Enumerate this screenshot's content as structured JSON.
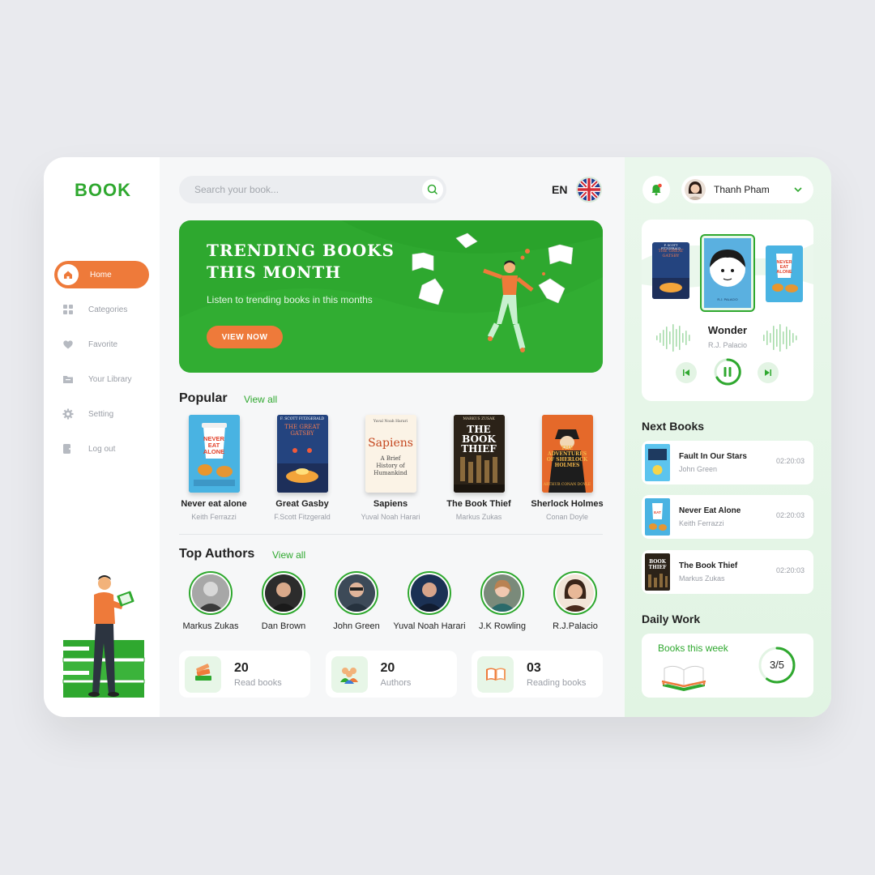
{
  "app": {
    "logo": "BOOK"
  },
  "sidebar": {
    "items": [
      {
        "label": "Home",
        "icon": "home-icon",
        "active": true
      },
      {
        "label": "Categories",
        "icon": "grid-icon"
      },
      {
        "label": "Favorite",
        "icon": "heart-icon"
      },
      {
        "label": "Your Library",
        "icon": "folder-icon"
      },
      {
        "label": "Setting",
        "icon": "gear-icon"
      },
      {
        "label": "Log out",
        "icon": "logout-icon"
      }
    ]
  },
  "header": {
    "search_placeholder": "Search your book...",
    "language": "EN",
    "flag": "uk-flag-icon"
  },
  "banner": {
    "title": "TRENDING BOOKS THIS MONTH",
    "subtitle": "Listen to trending books in this months",
    "button": "VIEW NOW"
  },
  "popular": {
    "title": "Popular",
    "view_all": "View all",
    "books": [
      {
        "title": "Never eat alone",
        "author": "Keith Ferrazzi"
      },
      {
        "title": "Great Gasby",
        "author": "F.Scott Fitzgerald"
      },
      {
        "title": "Sapiens",
        "author": "Yuval Noah Harari"
      },
      {
        "title": "The Book Thief",
        "author": "Markus Zukas"
      },
      {
        "title": "Sherlock Holmes",
        "author": "Conan Doyle"
      }
    ]
  },
  "covers": {
    "never_eat_alone": {
      "top": "NEVER EAT ALONE",
      "lines": [
        "NEVER",
        "EAT",
        "ALONE"
      ]
    },
    "gatsby": {
      "author": "F. SCOTT FITZGERALD",
      "title": "THE GREAT GATSBY"
    },
    "sapiens": {
      "author": "Yuval Noah Harari",
      "title": "Sapiens",
      "sub": "A Brief History of Humankind"
    },
    "book_thief": {
      "author": "MARKUS ZUSAK",
      "title": "THE BOOK THIEF"
    },
    "sherlock": {
      "title": "THE ADVENTURES OF SHERLOCK HOLMES",
      "author": "ARTHUR CONAN DOYLE"
    },
    "wonder": {
      "title": "wonder",
      "author": "R.J. PALACIO"
    }
  },
  "authors": {
    "title": "Top Authors",
    "view_all": "View all",
    "list": [
      {
        "name": "Markus Zukas"
      },
      {
        "name": "Dan Brown"
      },
      {
        "name": "John Green"
      },
      {
        "name": "Yuval Noah Harari"
      },
      {
        "name": "J.K Rowling"
      },
      {
        "name": "R.J.Palacio"
      }
    ]
  },
  "stats": [
    {
      "value": "20",
      "label": "Read books",
      "icon": "books-icon"
    },
    {
      "value": "20",
      "label": "Authors",
      "icon": "people-icon"
    },
    {
      "value": "03",
      "label": "Reading books",
      "icon": "open-book-icon"
    }
  ],
  "user": {
    "name": "Thanh Pham"
  },
  "player": {
    "title": "Wonder",
    "author": "R.J. Palacio"
  },
  "next_books": {
    "title": "Next Books",
    "items": [
      {
        "title": "Fault In Our Stars",
        "author": "John Green",
        "duration": "02:20:03"
      },
      {
        "title": "Never Eat Alone",
        "author": "Keith Ferrazzi",
        "duration": "02:20:03"
      },
      {
        "title": "The Book Thief",
        "author": "Markus Zukas",
        "duration": "02:20:03"
      }
    ]
  },
  "daily": {
    "title": "Daily Work",
    "label": "Books this week",
    "progress_text": "3/5",
    "progress_fraction": 0.6
  },
  "colors": {
    "green": "#2fa82f",
    "orange": "#ee7a3a"
  }
}
